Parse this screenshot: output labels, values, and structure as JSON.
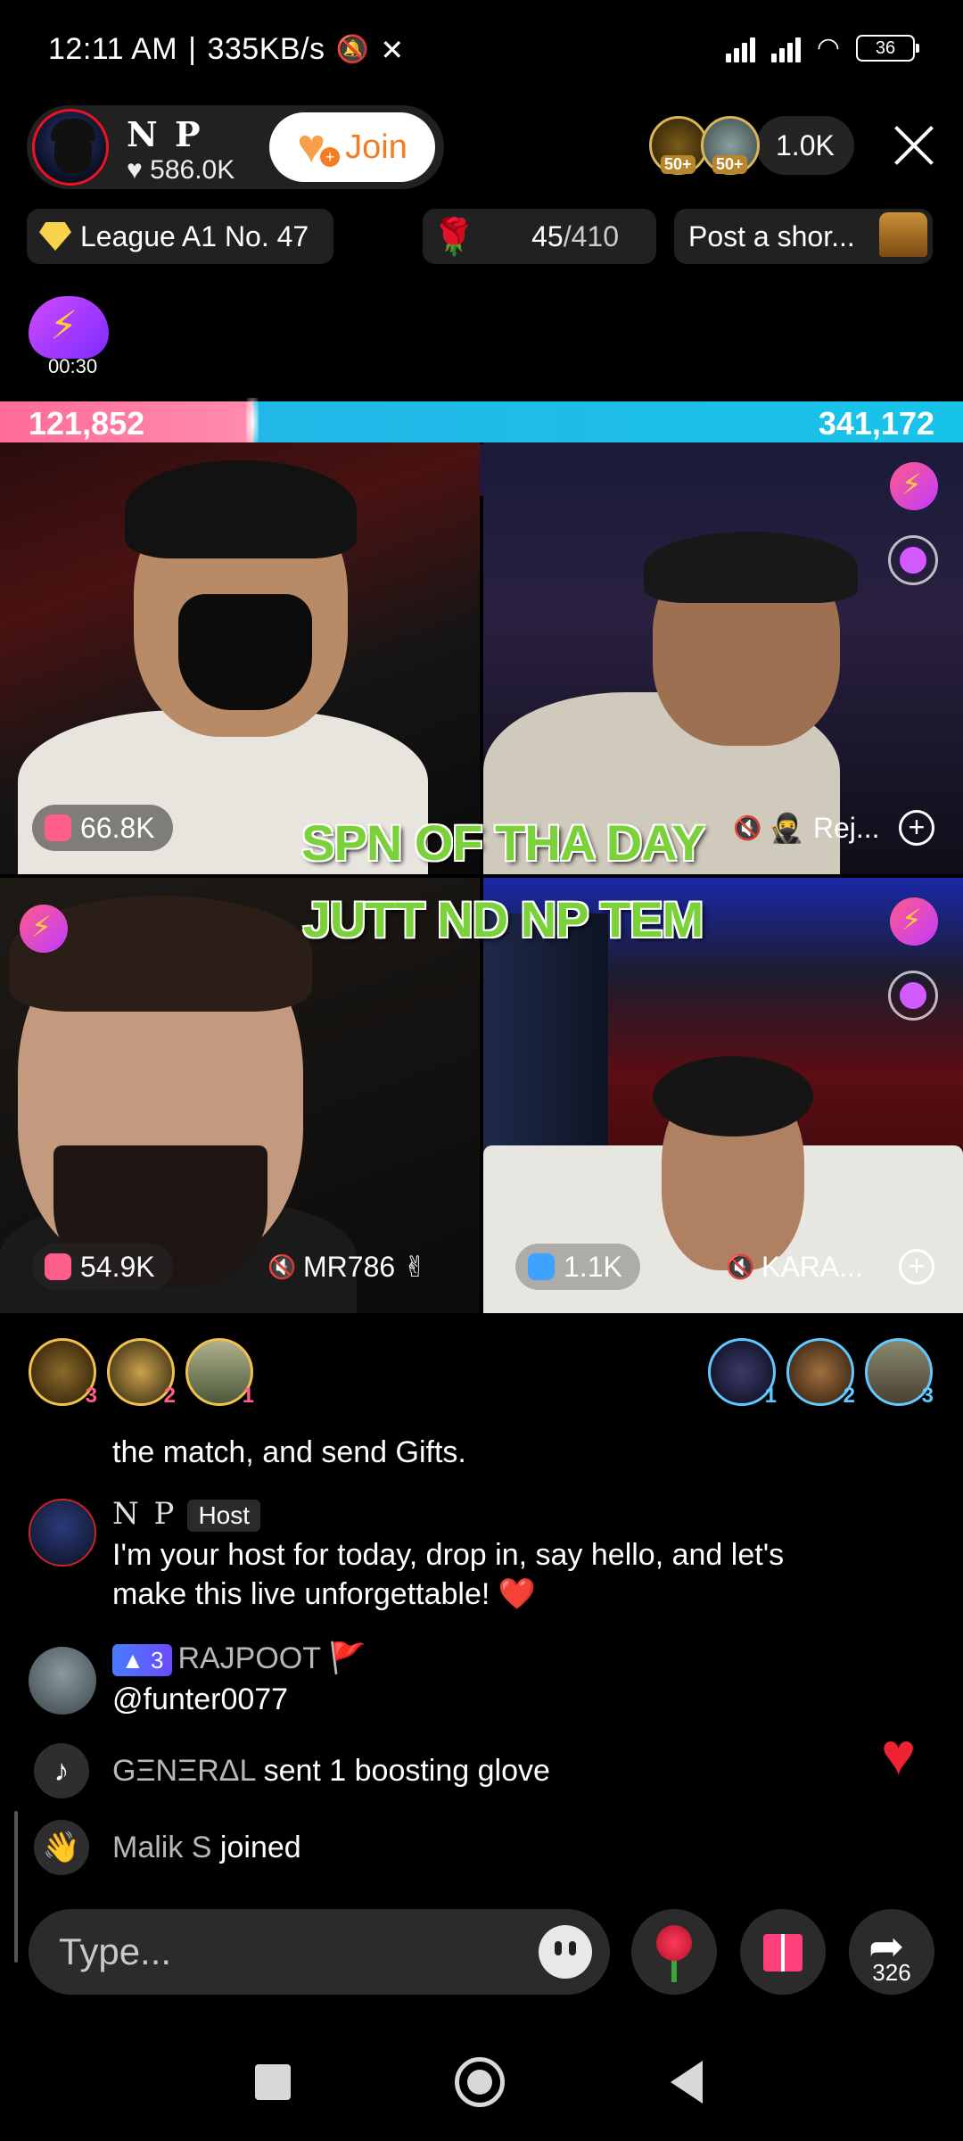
{
  "status_bar": {
    "time": "12:11 AM",
    "separator": "|",
    "speed": "335KB/s",
    "battery": "36",
    "icons": [
      "alarm-off-icon",
      "x-app-icon",
      "signal-icon",
      "signal-icon",
      "wifi-icon",
      "battery-icon"
    ]
  },
  "host": {
    "name": "N P",
    "likes": "586.0K",
    "join_label": "Join"
  },
  "viewers": {
    "badge1": "50+",
    "badge2": "50+",
    "count": "1.0K"
  },
  "pills": {
    "league": "League A1 No. 47",
    "rose_current": "45",
    "rose_total": "/410",
    "post": "Post a shor..."
  },
  "boost": {
    "timer": "00:30"
  },
  "battle": {
    "score_left": "121,852",
    "score_right": "341,172",
    "left_fraction": 0.263,
    "mission_count": "6"
  },
  "tiles": [
    {
      "stat": "66.8K",
      "name": ""
    },
    {
      "stat": "",
      "name": "Rej..."
    },
    {
      "stat": "54.9K",
      "name": "MR786 ✌"
    },
    {
      "stat": "1.1K",
      "name": "KARA..."
    }
  ],
  "overlay": {
    "line1": "SPN OF THA DAY",
    "line2": "JUTT ND NP TEM"
  },
  "supporters": {
    "left_ranks": [
      "3",
      "2",
      "1"
    ],
    "right_ranks": [
      "1",
      "2",
      "3"
    ]
  },
  "chat": {
    "line0": "the match, and send Gifts.",
    "host_name": "N P",
    "host_tag": "Host",
    "host_msg1": "I'm your host for today, drop in, say hello, and let's",
    "host_msg2": "make this live unforgettable! ❤️",
    "user_rank": "3",
    "user_name": "RAJPOOT 🚩",
    "user_msg": "@funter0077",
    "gift_user": "GΞNΞRΔL",
    "gift_text": "sent 1 boosting glove",
    "join_user": "Malik S",
    "join_text": "joined"
  },
  "input": {
    "placeholder": "Type...",
    "share_count": "326"
  },
  "colors": {
    "battle_left": "#ff6c98",
    "battle_right": "#25b3e6",
    "overlay_text": "#7ad13a",
    "join_text": "#f57c20"
  }
}
